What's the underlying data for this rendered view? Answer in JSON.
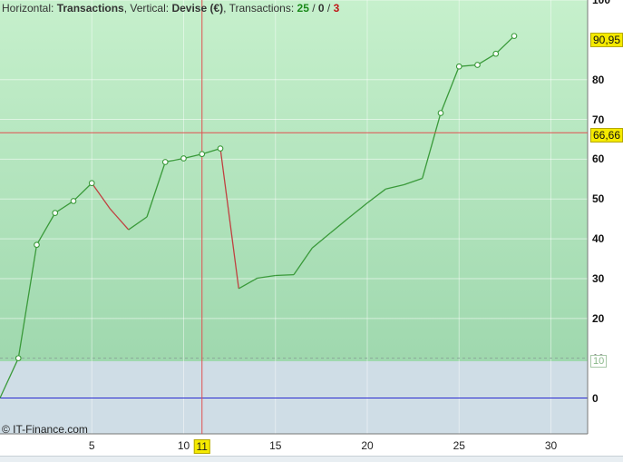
{
  "header": {
    "horizontal_label": "Horizontal:",
    "horizontal_value": "Transactions",
    "vertical_label": ", Vertical:",
    "vertical_value": "Devise (€)",
    "transactions_label": ", Transactions:",
    "win_count": "25",
    "sep1": " / ",
    "neutral_count": "0",
    "sep2": " / ",
    "loss_count": "3"
  },
  "credit": "© IT-Finance.com",
  "y_ticks": [
    "100",
    "80",
    "70",
    "60",
    "50",
    "40",
    "30",
    "20",
    "10",
    "0"
  ],
  "x_ticks": [
    "5",
    "10",
    "11",
    "15",
    "20",
    "25",
    "30"
  ],
  "value_labels": {
    "last": "90,95",
    "cursor": "66,66",
    "threshold": "10"
  },
  "colors": {
    "up_line": "#3a9a3a",
    "down_line": "#c04040",
    "cursor": "#e05050",
    "zero_line": "#2a2ad0",
    "bg_top": "#c6f0cc",
    "bg_bottom": "#9fd8ae",
    "below_threshold": "#cfdde6"
  },
  "chart_data": {
    "type": "line",
    "xlabel": "",
    "ylabel": "",
    "xlim": [
      0,
      32
    ],
    "ylim": [
      -9,
      100
    ],
    "grid": true,
    "cursor": {
      "x": 11,
      "y": 66.66
    },
    "threshold": 10,
    "zero_line": 0,
    "x": [
      0,
      1,
      2,
      3,
      4,
      5,
      6,
      7,
      8,
      9,
      10,
      11,
      12,
      13,
      14,
      15,
      16,
      17,
      18,
      19,
      20,
      21,
      22,
      23,
      24,
      25,
      26,
      27,
      28
    ],
    "y": [
      0,
      10,
      38.5,
      46.5,
      49.5,
      54,
      47.5,
      42.3,
      45.5,
      59.3,
      60.2,
      61.3,
      62.7,
      27.5,
      30.1,
      30.8,
      31,
      37.7,
      41.5,
      45.3,
      49,
      52.5,
      53.6,
      55.2,
      71.6,
      83.3,
      83.7,
      86.5,
      90.95
    ],
    "markers": [
      1,
      2,
      3,
      4,
      5,
      9,
      10,
      11,
      12,
      24,
      25,
      26,
      27,
      28
    ]
  }
}
